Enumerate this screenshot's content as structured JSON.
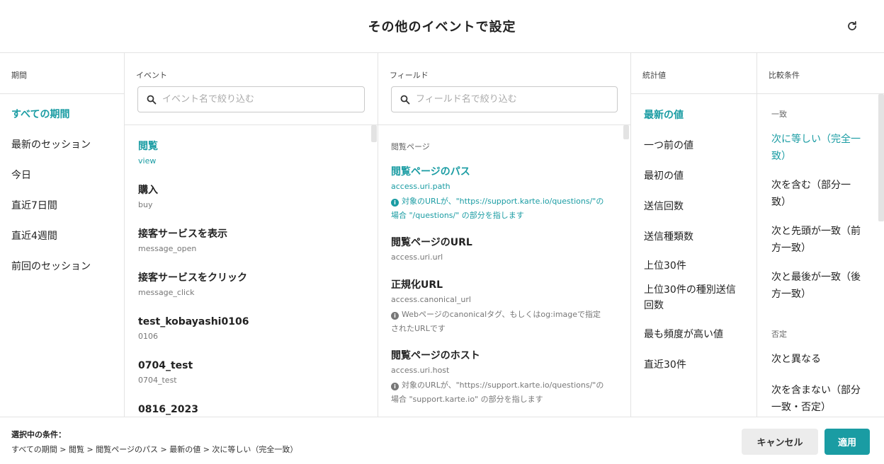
{
  "header": {
    "title": "その他のイベントで設定"
  },
  "period": {
    "heading": "期間",
    "items": [
      "すべての期間",
      "最新のセッション",
      "今日",
      "直近7日間",
      "直近4週間",
      "前回のセッション"
    ]
  },
  "event": {
    "heading": "イベント",
    "placeholder": "イベント名で絞り込む",
    "items": [
      {
        "name": "閲覧",
        "key": "view"
      },
      {
        "name": "購入",
        "key": "buy"
      },
      {
        "name": "接客サービスを表示",
        "key": "message_open"
      },
      {
        "name": "接客サービスをクリック",
        "key": "message_click"
      },
      {
        "name": "test_kobayashi0106",
        "key": "0106"
      },
      {
        "name": "0704_test",
        "key": "0704_test"
      },
      {
        "name": "0816_2023",
        "key": ""
      }
    ]
  },
  "field": {
    "heading": "フィールド",
    "placeholder": "フィールド名で絞り込む",
    "group_label": "閲覧ページ",
    "items": [
      {
        "name": "閲覧ページのパス",
        "key": "access.uri.path",
        "desc1": "対象のURLが、\"https://support.karte.io/questions/\"の",
        "desc2": "場合 \"/questions/\" の部分を指します"
      },
      {
        "name": "閲覧ページのURL",
        "key": "access.uri.url",
        "desc1": "",
        "desc2": ""
      },
      {
        "name": "正規化URL",
        "key": "access.canonical_url",
        "desc1": "Webページのcanonicalタグ、もしくはog:imageで指定",
        "desc2": "されたURLです"
      },
      {
        "name": "閲覧ページのホスト",
        "key": "access.uri.host",
        "desc1": "対象のURLが、\"https://support.karte.io/questions/\"の",
        "desc2": "場合 \"support.karte.io\" の部分を指します"
      }
    ]
  },
  "stat": {
    "heading": "統計値",
    "items": [
      {
        "l1": "最新の値",
        "l2": ""
      },
      {
        "l1": "一つ前の値",
        "l2": ""
      },
      {
        "l1": "最初の値",
        "l2": ""
      },
      {
        "l1": "送信回数",
        "l2": ""
      },
      {
        "l1": "送信種類数",
        "l2": ""
      },
      {
        "l1": "上位30件",
        "l2": ""
      },
      {
        "l1": "上位30件の種別送信",
        "l2": "回数"
      },
      {
        "l1": "最も頻度が高い値",
        "l2": ""
      },
      {
        "l1": "直近30件",
        "l2": ""
      }
    ]
  },
  "compare": {
    "heading": "比較条件",
    "group_match": "一致",
    "group_negate": "否定",
    "items": [
      {
        "l1": "次に等しい（完全一",
        "l2": "致）"
      },
      {
        "l1": "次を含む（部分一",
        "l2": "致）"
      },
      {
        "l1": "次と先頭が一致（前",
        "l2": "方一致）"
      },
      {
        "l1": "次と最後が一致（後",
        "l2": "方一致）"
      },
      {
        "l1": "次と異なる",
        "l2": ""
      },
      {
        "l1": "次を含まない（部分",
        "l2": "一致・否定）"
      }
    ]
  },
  "footer": {
    "label": "選択中の条件：",
    "path": "すべての期間 > 閲覧 > 閲覧ページのパス > 最新の値 > 次に等しい（完全一致）",
    "cancel": "キャンセル",
    "apply": "適用"
  },
  "icons": {
    "reload": "reload-icon",
    "search": "search-icon",
    "info": "info-icon"
  },
  "colors": {
    "accent": "#1a9ca3"
  }
}
